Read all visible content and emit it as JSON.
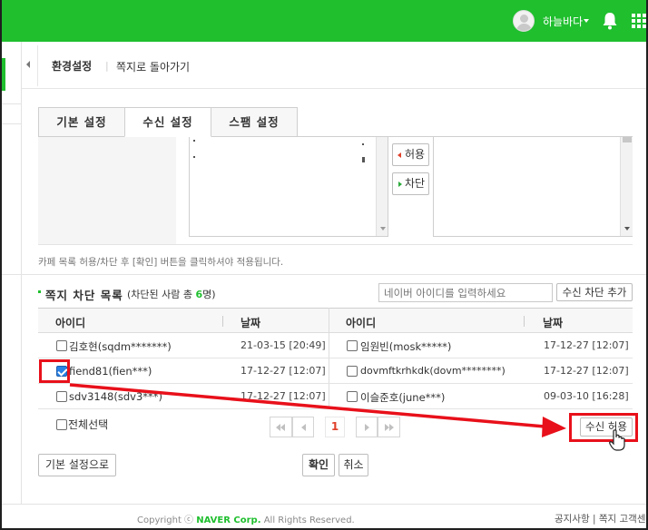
{
  "header": {
    "username": "하늘바다",
    "icons": [
      "user-avatar",
      "caret-down",
      "bell-icon",
      "apps-grid-icon"
    ],
    "accent_color": "#1fbf2e"
  },
  "breadcrumb": {
    "title": "환경설정",
    "separator": "|",
    "back_link": "쪽지로 돌아가기"
  },
  "tabs": [
    {
      "label": "기본 설정",
      "active": false
    },
    {
      "label": "수신 설정",
      "active": true
    },
    {
      "label": "스팸 설정",
      "active": false
    }
  ],
  "cafe_controls": {
    "allow_label": "허용",
    "block_label": "차단"
  },
  "notice": "카페 목록 허용/차단 후 [확인] 버튼을 클릭하셔야 적용됩니다.",
  "block_list": {
    "title": "쪽지 차단 목록",
    "subtitle_prefix": "(차단된 사람 총 ",
    "count": "6",
    "subtitle_suffix": "명)",
    "search_placeholder": "네이버 아이디를 입력하세요",
    "add_button": "수신 차단 추가"
  },
  "table": {
    "headers": [
      "아이디",
      "날짜",
      "아이디",
      "날짜"
    ],
    "rows": [
      {
        "left_id": "김호현(sqdm*******)",
        "left_date": "21-03-15 [20:49]",
        "left_checked": false,
        "right_id": "임원빈(mosk*****)",
        "right_date": "17-12-27 [12:07]",
        "right_checked": false
      },
      {
        "left_id": "fiend81(fien***)",
        "left_date": "17-12-27 [12:07]",
        "left_checked": true,
        "right_id": "dovmftkrhkdk(dovm********)",
        "right_date": "17-12-27 [12:07]",
        "right_checked": false
      },
      {
        "left_id": "sdv3148(sdv3***)",
        "left_date": "17-12-27 [12:07]",
        "left_checked": false,
        "right_id": "이슬준호(june***)",
        "right_date": "09-03-10 [16:28]",
        "right_checked": false
      }
    ]
  },
  "select_all": "전체선택",
  "pagination": {
    "current": "1"
  },
  "accept_button": "수신 허용",
  "bottom_buttons": {
    "default": "기본 설정으로",
    "confirm": "확인",
    "cancel": "취소"
  },
  "footer": {
    "copyright_prefix": "Copyright ⓒ ",
    "company": "NAVER Corp.",
    "copyright_suffix": " All Rights Reserved.",
    "links": "공지사항 | 쪽지 고객센"
  },
  "annotation_color": "#e8101a"
}
